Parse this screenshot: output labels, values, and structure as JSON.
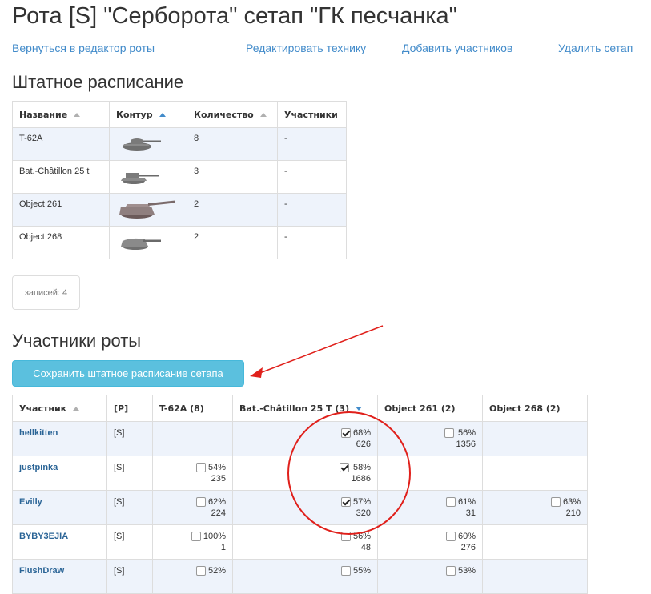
{
  "page_title": "Рота [S] \"Серборота\" сетап \"ГК песчанка\"",
  "links": {
    "back": "Вернуться в редактор роты",
    "edit_vehicles": "Редактировать технику",
    "add_members": "Добавить участников",
    "delete_setup": "Удалить сетап"
  },
  "staff": {
    "heading": "Штатное расписание",
    "columns": [
      "Название",
      "Контур",
      "Количество",
      "Участники"
    ],
    "rows": [
      {
        "name": "T-62A",
        "count": "8",
        "members": "-"
      },
      {
        "name": "Bat.-Châtillon 25 t",
        "count": "3",
        "members": "-"
      },
      {
        "name": "Object 261",
        "count": "2",
        "members": "-"
      },
      {
        "name": "Object 268",
        "count": "2",
        "members": "-"
      }
    ],
    "records": "записей: 4"
  },
  "members": {
    "heading": "Участники роты",
    "save_button": "Сохранить штатное расписание сетапа",
    "columns": [
      "Участник",
      "[P]",
      "T-62A (8)",
      "Bat.-Châtillon 25 T (3)",
      "Object 261 (2)",
      "Object 268 (2)"
    ],
    "rows": [
      {
        "name": "hellkitten",
        "role": "[S]",
        "cells": [
          null,
          {
            "checked": true,
            "pct": "68%",
            "battles": "626"
          },
          {
            "checked": false,
            "pct": "56%",
            "battles": "1356"
          },
          null
        ]
      },
      {
        "name": "justpinka",
        "role": "[S]",
        "cells": [
          {
            "checked": false,
            "pct": "54%",
            "battles": "235"
          },
          {
            "checked": true,
            "pct": "58%",
            "battles": "1686"
          },
          null,
          null
        ]
      },
      {
        "name": "Evilly",
        "role": "[S]",
        "cells": [
          {
            "checked": false,
            "pct": "62%",
            "battles": "224"
          },
          {
            "checked": true,
            "pct": "57%",
            "battles": "320"
          },
          {
            "checked": false,
            "pct": "61%",
            "battles": "31"
          },
          {
            "checked": false,
            "pct": "63%",
            "battles": "210"
          }
        ]
      },
      {
        "name": "BYBY3EJIA",
        "role": "[S]",
        "cells": [
          {
            "checked": false,
            "pct": "100%",
            "battles": "1"
          },
          {
            "checked": false,
            "pct": "56%",
            "battles": "48"
          },
          {
            "checked": false,
            "pct": "60%",
            "battles": "276"
          },
          null
        ]
      },
      {
        "name": "FlushDraw",
        "role": "[S]",
        "cells": [
          {
            "checked": false,
            "pct": "52%",
            "battles": ""
          },
          {
            "checked": false,
            "pct": "55%",
            "battles": ""
          },
          {
            "checked": false,
            "pct": "53%",
            "battles": ""
          },
          null
        ]
      }
    ]
  },
  "colors": {
    "link": "#428bca",
    "button": "#5bc0de",
    "row_stripe": "#eef3fb",
    "annotation": "#e0201b"
  }
}
